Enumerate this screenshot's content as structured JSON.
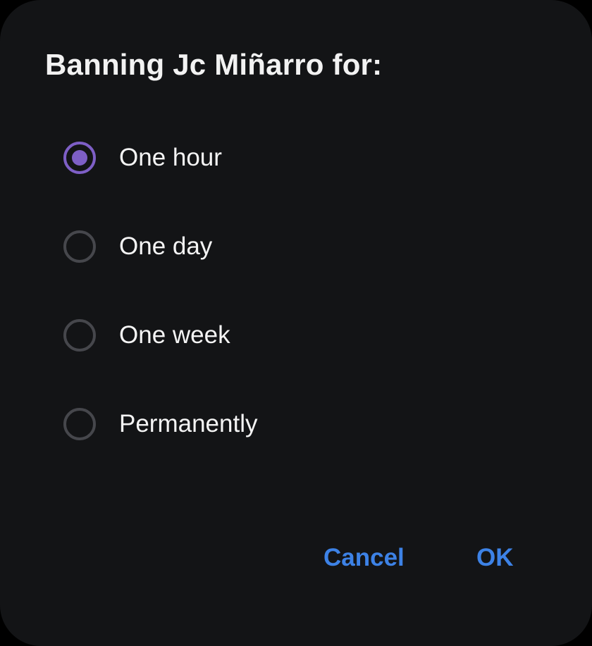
{
  "dialog": {
    "title": "Banning Jc Miñarro for:",
    "options": [
      {
        "label": "One hour",
        "selected": true
      },
      {
        "label": "One day",
        "selected": false
      },
      {
        "label": "One week",
        "selected": false
      },
      {
        "label": "Permanently",
        "selected": false
      }
    ],
    "buttons": {
      "cancel": "Cancel",
      "ok": "OK"
    }
  },
  "colors": {
    "background": "#131416",
    "accent_radio": "#7e5fc6",
    "radio_unselected": "#46474c",
    "button_text": "#3d82e6",
    "text": "#f4f4f4"
  }
}
